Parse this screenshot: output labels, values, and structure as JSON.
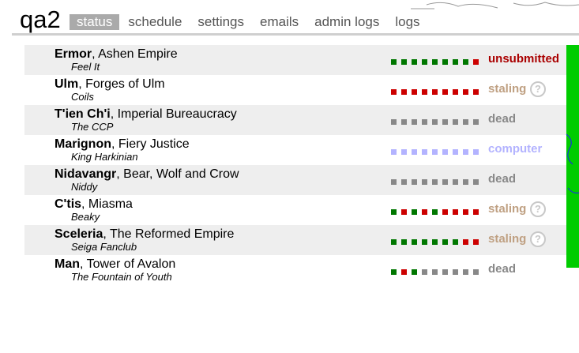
{
  "header": {
    "game_title": "qa2",
    "tabs": [
      {
        "label": "status",
        "active": true
      },
      {
        "label": "schedule",
        "active": false
      },
      {
        "label": "settings",
        "active": false
      },
      {
        "label": "emails",
        "active": false
      },
      {
        "label": "admin logs",
        "active": false
      },
      {
        "label": "logs",
        "active": false
      }
    ]
  },
  "colors": {
    "green": "#007700",
    "red": "#cc0000",
    "grey": "#888888",
    "lavender": "#b3b3ff",
    "unsubmitted": "#aa0000",
    "staling": "#bfa082",
    "dead": "#888888",
    "computer": "#b3b3ff",
    "progress": "#00cc00"
  },
  "nations": [
    {
      "name": "Ermor",
      "epithet": ", Ashen Empire",
      "player": "Feel It",
      "status": "unsubmitted",
      "status_color": "#aa0000",
      "help": false,
      "turns": [
        "green",
        "green",
        "green",
        "green",
        "green",
        "green",
        "green",
        "green",
        "red"
      ]
    },
    {
      "name": "Ulm",
      "epithet": ", Forges of Ulm",
      "player": "Coils",
      "status": "staling",
      "status_color": "#bfa082",
      "help": true,
      "turns": [
        "red",
        "red",
        "red",
        "red",
        "red",
        "red",
        "red",
        "red",
        "red"
      ]
    },
    {
      "name": "T'ien Ch'i",
      "epithet": ", Imperial Bureaucracy",
      "player": "The CCP",
      "status": "dead",
      "status_color": "#888888",
      "help": false,
      "turns": [
        "grey",
        "grey",
        "grey",
        "grey",
        "grey",
        "grey",
        "grey",
        "grey",
        "grey"
      ]
    },
    {
      "name": "Marignon",
      "epithet": ", Fiery Justice",
      "player": "King Harkinian",
      "status": "computer",
      "status_color": "#b3b3ff",
      "help": false,
      "turns": [
        "lavender",
        "lavender",
        "lavender",
        "lavender",
        "lavender",
        "lavender",
        "lavender",
        "lavender",
        "lavender"
      ]
    },
    {
      "name": "Nidavangr",
      "epithet": ", Bear, Wolf and Crow",
      "player": "Niddy",
      "status": "dead",
      "status_color": "#888888",
      "help": false,
      "turns": [
        "grey",
        "grey",
        "grey",
        "grey",
        "grey",
        "grey",
        "grey",
        "grey",
        "grey"
      ]
    },
    {
      "name": "C'tis",
      "epithet": ", Miasma",
      "player": "Beaky",
      "status": "staling",
      "status_color": "#bfa082",
      "help": true,
      "turns": [
        "green",
        "red",
        "green",
        "red",
        "green",
        "red",
        "red",
        "red",
        "red"
      ]
    },
    {
      "name": "Sceleria",
      "epithet": ", The Reformed Empire",
      "player": "Seiga Fanclub",
      "status": "staling",
      "status_color": "#bfa082",
      "help": true,
      "turns": [
        "green",
        "green",
        "green",
        "green",
        "green",
        "green",
        "green",
        "red",
        "red"
      ]
    },
    {
      "name": "Man",
      "epithet": ", Tower of Avalon",
      "player": "The Fountain of Youth",
      "status": "dead",
      "status_color": "#888888",
      "help": false,
      "turns": [
        "green",
        "red",
        "green",
        "grey",
        "grey",
        "grey",
        "grey",
        "grey",
        "grey"
      ]
    }
  ]
}
